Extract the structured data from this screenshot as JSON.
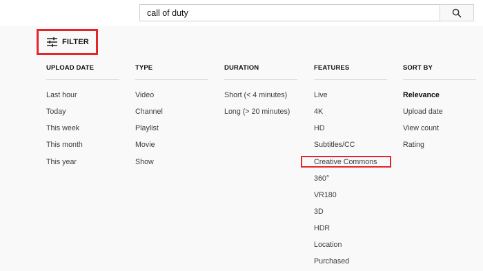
{
  "search": {
    "query": "call of duty"
  },
  "filter": {
    "label": "FILTER"
  },
  "columns": [
    {
      "header": "UPLOAD DATE",
      "options": [
        "Last hour",
        "Today",
        "This week",
        "This month",
        "This year"
      ]
    },
    {
      "header": "TYPE",
      "options": [
        "Video",
        "Channel",
        "Playlist",
        "Movie",
        "Show"
      ]
    },
    {
      "header": "DURATION",
      "options": [
        "Short (< 4 minutes)",
        "Long (> 20 minutes)"
      ]
    },
    {
      "header": "FEATURES",
      "options": [
        "Live",
        "4K",
        "HD",
        "Subtitles/CC",
        "Creative Commons",
        "360°",
        "VR180",
        "3D",
        "HDR",
        "Location",
        "Purchased"
      ]
    },
    {
      "header": "SORT BY",
      "options": [
        "Relevance",
        "Upload date",
        "View count",
        "Rating"
      ]
    }
  ],
  "selected_sort": "Relevance",
  "highlighted_feature": "Creative Commons",
  "colors": {
    "highlight_box": "#e2262b",
    "background": "#f9f9f9"
  }
}
